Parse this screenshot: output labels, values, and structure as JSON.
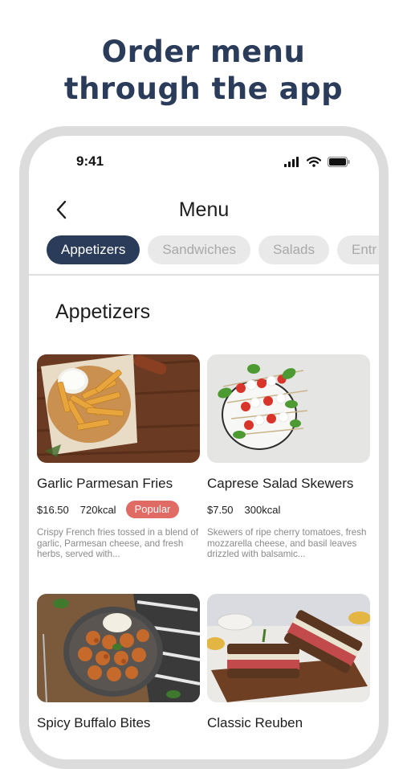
{
  "headline": {
    "line1": "Order menu",
    "line2": "through the app"
  },
  "status_bar": {
    "time": "9:41"
  },
  "nav": {
    "title": "Menu"
  },
  "tabs": [
    {
      "label": "Appetizers",
      "active": true
    },
    {
      "label": "Sandwiches",
      "active": false
    },
    {
      "label": "Salads",
      "active": false
    },
    {
      "label": "Entr",
      "active": false
    }
  ],
  "section": {
    "title": "Appetizers"
  },
  "items": [
    {
      "name": "Garlic Parmesan Fries",
      "price": "$16.50",
      "kcal": "720kcal",
      "badge": "Popular",
      "description": "Crispy French fries tossed in a blend of garlic, Parmesan cheese, and fresh herbs, served with..."
    },
    {
      "name": "Caprese Salad Skewers",
      "price": "$7.50",
      "kcal": "300kcal",
      "description": "Skewers of ripe cherry tomatoes, fresh mozzarella cheese, and basil leaves drizzled with balsamic..."
    },
    {
      "name": "Spicy Buffalo Bites"
    },
    {
      "name": "Classic Reuben"
    }
  ],
  "colors": {
    "brand_navy": "#2b3c5a",
    "popular_badge": "#e06a64",
    "inactive_tab": "#e9e9e9"
  }
}
